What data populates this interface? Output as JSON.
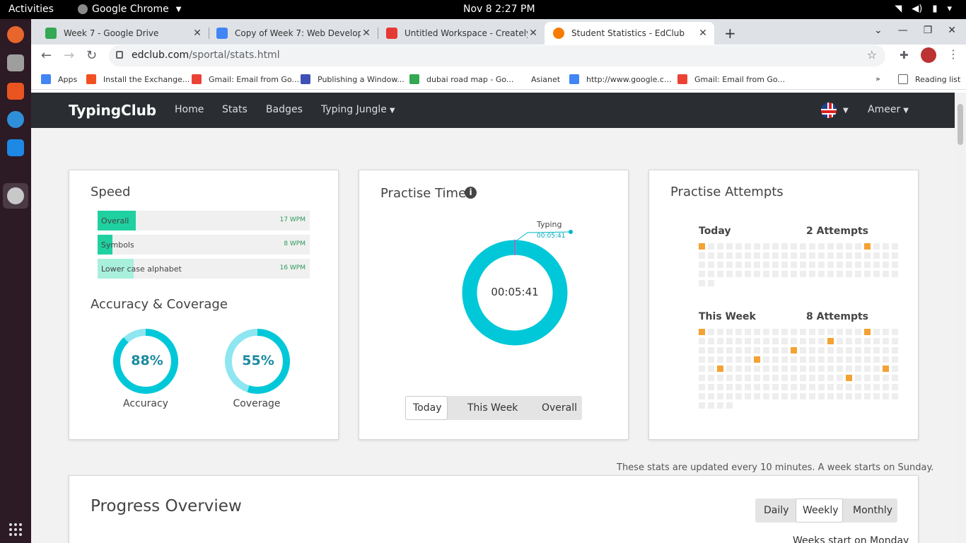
{
  "system": {
    "activities": "Activities",
    "app_name": "Google Chrome",
    "clock": "Nov 8  2:27 PM"
  },
  "browser": {
    "tabs": [
      {
        "title": "Week 7 - Google Drive",
        "favicon_color": "#34a853"
      },
      {
        "title": "Copy of Week 7: Web Development",
        "favicon_color": "#4285f4"
      },
      {
        "title": "Untitled Workspace - Creately",
        "favicon_color": "#e53935"
      },
      {
        "title": "Student Statistics - EdClub",
        "favicon_color": "#f57c00"
      }
    ],
    "active_tab": 3,
    "url_host": "edclub.com",
    "url_path": "/sportal/stats.html",
    "bookmarks": [
      {
        "label": "Apps",
        "color": "#4285f4"
      },
      {
        "label": "Install the Exchange...",
        "color": "#f25022"
      },
      {
        "label": "Gmail: Email from Go...",
        "color": "#ea4335"
      },
      {
        "label": "Publishing a Window...",
        "color": "#3f51b5"
      },
      {
        "label": "dubai road map - Go...",
        "color": "#34a853"
      },
      {
        "label": "Asianet",
        "color": "#ffffff"
      },
      {
        "label": "http://www.google.c...",
        "color": "#4285f4"
      },
      {
        "label": "Gmail: Email from Go...",
        "color": "#ea4335"
      }
    ],
    "reading_list": "Reading list"
  },
  "site": {
    "brand": "TypingClub",
    "nav": [
      "Home",
      "Stats",
      "Badges",
      "Typing Jungle"
    ],
    "user": "Ameer"
  },
  "speed": {
    "title": "Speed",
    "bars": [
      {
        "label": "Overall",
        "wpm": "17 WPM",
        "fraction": 0.18,
        "color": "#1fd0a0"
      },
      {
        "label": "Symbols",
        "wpm": "8 WPM",
        "fraction": 0.07,
        "color": "#1fd0a0"
      },
      {
        "label": "Lower case alphabet",
        "wpm": "16 WPM",
        "fraction": 0.17,
        "color": "#a8f0dc"
      }
    ]
  },
  "accuracy": {
    "title": "Accuracy & Coverage",
    "accuracy_pct": "88%",
    "accuracy_value": 0.88,
    "accuracy_label": "Accuracy",
    "coverage_pct": "55%",
    "coverage_value": 0.55,
    "coverage_label": "Coverage"
  },
  "practice_time": {
    "title": "Practise Time",
    "center": "00:05:41",
    "callout_label": "Typing",
    "callout_value": "00:05:41",
    "tabs": [
      "Today",
      "This Week",
      "Overall"
    ],
    "selected": "Today"
  },
  "attempts": {
    "title": "Practise Attempts",
    "today_label": "Today",
    "today_count": "2 Attempts",
    "today_value": 2,
    "week_label": "This Week",
    "week_count": "8 Attempts",
    "week_value": 8
  },
  "note": "These stats are updated every 10 minutes. A week starts on Sunday.",
  "progress": {
    "title": "Progress Overview",
    "tabs": [
      "Daily",
      "Weekly",
      "Monthly"
    ],
    "selected": "Weekly",
    "week_note": "Weeks start on Monday"
  }
}
